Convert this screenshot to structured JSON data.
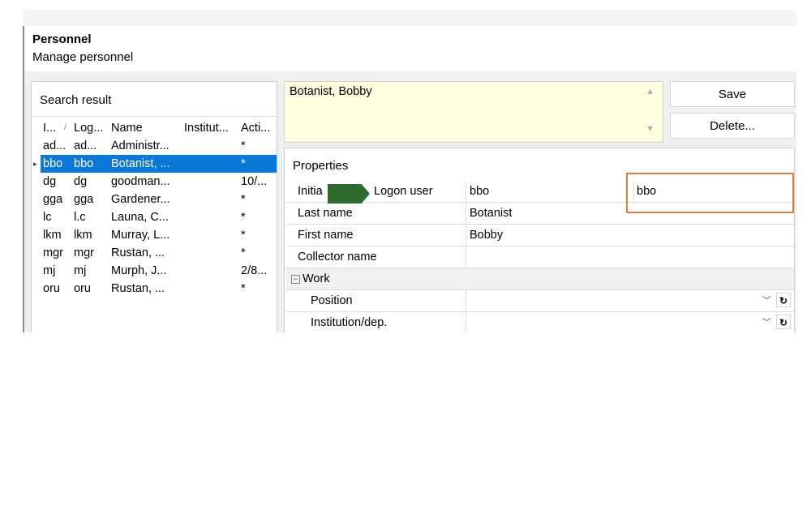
{
  "header": {
    "title": "Personnel",
    "subtitle": "Manage personnel"
  },
  "search": {
    "title": "Search result",
    "columns": [
      "I...",
      "Log...",
      "Name",
      "Institut...",
      "Acti..."
    ],
    "rows": [
      [
        "ad...",
        "ad...",
        "Administr...",
        "",
        "*"
      ],
      [
        "bbo",
        "bbo",
        "Botanist, ...",
        "",
        "*"
      ],
      [
        "dg",
        "dg",
        "goodman...",
        "",
        "10/..."
      ],
      [
        "gga",
        "gga",
        "Gardener...",
        "",
        "*"
      ],
      [
        "lc",
        "l.c",
        "Launa, C...",
        "",
        "*"
      ],
      [
        "lkm",
        "lkm",
        "Murray, L...",
        "",
        "*"
      ],
      [
        "mgr",
        "mgr",
        "Rustan, ...",
        "",
        "*"
      ],
      [
        "mj",
        "mj",
        "Murph, J...",
        "",
        "2/8..."
      ],
      [
        "oru",
        "oru",
        "Rustan, ...",
        "",
        "*"
      ]
    ],
    "selected_row": 1
  },
  "record": {
    "display_name": "Botanist, Bobby"
  },
  "buttons": {
    "save": "Save",
    "delete": "Delete..."
  },
  "properties": {
    "title": "Properties",
    "rows": {
      "initials": {
        "label": "Initia",
        "value": "bbo"
      },
      "logon": {
        "label": "Logon user",
        "value": "bbo"
      },
      "last_name": {
        "label": "Last name",
        "value": "Botanist"
      },
      "first_name": {
        "label": "First name",
        "value": "Bobby"
      },
      "collector": {
        "label": "Collector name",
        "value": ""
      },
      "work_group": {
        "label": "Work"
      },
      "position": {
        "label": "Position",
        "value": ""
      },
      "institution": {
        "label": "Institution/dep.",
        "value": ""
      }
    }
  },
  "colors": {
    "selection": "#0a78d7",
    "name_bg": "#ffffe0",
    "marker": "#2f6b2f",
    "highlight": "#d9823b"
  },
  "icons": {
    "expand": "collapse-minus-icon",
    "dropdown": "chevron-down-icon",
    "refresh": "refresh-icon"
  }
}
